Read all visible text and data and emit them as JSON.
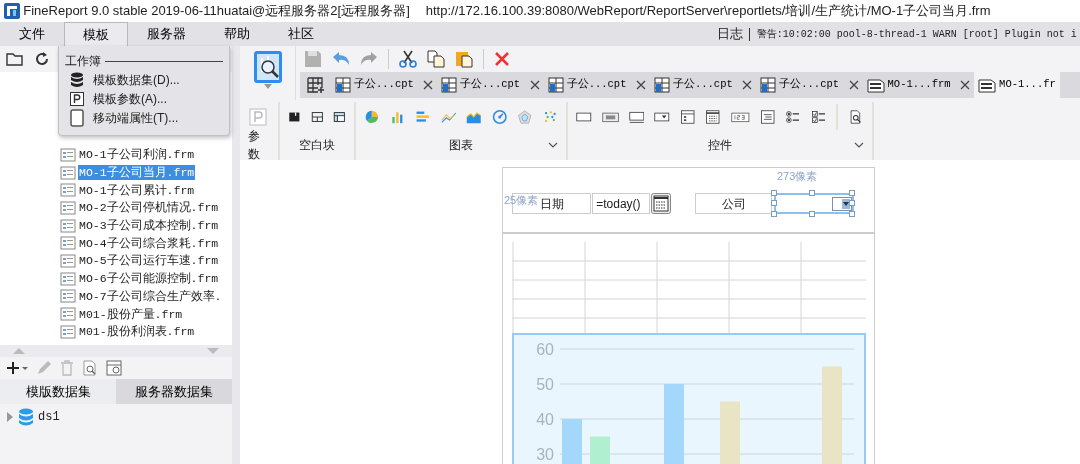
{
  "window": {
    "title": "FineReport 9.0 stable 2019-06-11huatai@远程服务器2[远程服务器]",
    "path": "http://172.16.100.39:8080/WebReport/ReportServer\\reportlets/培训/生产统计/MO-1子公司当月.frm"
  },
  "menu": [
    {
      "label": "文件",
      "selected": false
    },
    {
      "label": "模板",
      "selected": true
    },
    {
      "label": "服务器",
      "selected": false
    },
    {
      "label": "帮助",
      "selected": false
    },
    {
      "label": "社区",
      "selected": false
    }
  ],
  "log": {
    "label": "日志",
    "message": "警告:10:02:00 pool-8-thread-1 WARN [root] Plugin not i"
  },
  "template_menu": {
    "section": "工作簿",
    "items": [
      {
        "kind": "dataset",
        "label": "模板数据集(D)..."
      },
      {
        "kind": "parameter",
        "label": "模板参数(A)..."
      },
      {
        "kind": "mobile",
        "label": "移动端属性(T)..."
      }
    ]
  },
  "file_tree": [
    {
      "label": "MO-1子公司利润.frm",
      "selected": false
    },
    {
      "label": "MO-1子公司当月.frm",
      "selected": true
    },
    {
      "label": "MO-1子公司累计.frm",
      "selected": false
    },
    {
      "label": "MO-2子公司停机情况.frm",
      "selected": false
    },
    {
      "label": "MO-3子公司成本控制.frm",
      "selected": false
    },
    {
      "label": "MO-4子公司综合浆耗.frm",
      "selected": false
    },
    {
      "label": "MO-5子公司运行车速.frm",
      "selected": false
    },
    {
      "label": "MO-6子公司能源控制.frm",
      "selected": false
    },
    {
      "label": "MO-7子公司综合生产效率.",
      "selected": false
    },
    {
      "label": "M01-股份产量.frm",
      "selected": false
    },
    {
      "label": "M01-股份利润表.frm",
      "selected": false
    }
  ],
  "dataset_tabs": [
    {
      "label": "模版数据集",
      "selected": true
    },
    {
      "label": "服务器数据集",
      "selected": false
    }
  ],
  "datasets": [
    {
      "label": "ds1",
      "expanded": false
    }
  ],
  "toolbar": [
    {
      "kind": "save",
      "disabled": true
    },
    {
      "kind": "undo",
      "disabled": false
    },
    {
      "kind": "redo",
      "disabled": true
    },
    {
      "kind": "cut",
      "disabled": false
    },
    {
      "kind": "copy",
      "disabled": false
    },
    {
      "kind": "paste",
      "disabled": false
    },
    {
      "kind": "delete",
      "disabled": false
    }
  ],
  "file_tabs": [
    {
      "kind": "cpt",
      "label": "子公...cpt",
      "selected": false
    },
    {
      "kind": "cpt",
      "label": "子公...cpt",
      "selected": false
    },
    {
      "kind": "cpt",
      "label": "子公...cpt",
      "selected": false
    },
    {
      "kind": "cpt",
      "label": "子公...cpt",
      "selected": false
    },
    {
      "kind": "cpt",
      "label": "子公...cpt",
      "selected": false
    },
    {
      "kind": "frm",
      "label": "MO-1...frm",
      "selected": false
    },
    {
      "kind": "frm",
      "label": "MO-1...fr",
      "selected": true
    }
  ],
  "ribbon": [
    {
      "label": "参数"
    },
    {
      "label": "空白块"
    },
    {
      "label": "图表"
    },
    {
      "label": "控件"
    }
  ],
  "form": {
    "date_label": "日期",
    "date_value": "=today()",
    "company_label": "公司",
    "combo_selected": true,
    "height_note": "25像素",
    "width_note": "273像素"
  },
  "chart_data": {
    "type": "bar",
    "ylim": [
      30,
      60
    ],
    "yticks": [
      30,
      40,
      50,
      60
    ],
    "series": [
      {
        "color": "#a3d8fa",
        "values": [
          40,
          50,
          null
        ]
      },
      {
        "color": "#b0f0d0",
        "values": [
          35,
          null,
          null
        ]
      },
      {
        "color": "#e8e4c4",
        "values": [
          null,
          45,
          55
        ]
      }
    ]
  }
}
